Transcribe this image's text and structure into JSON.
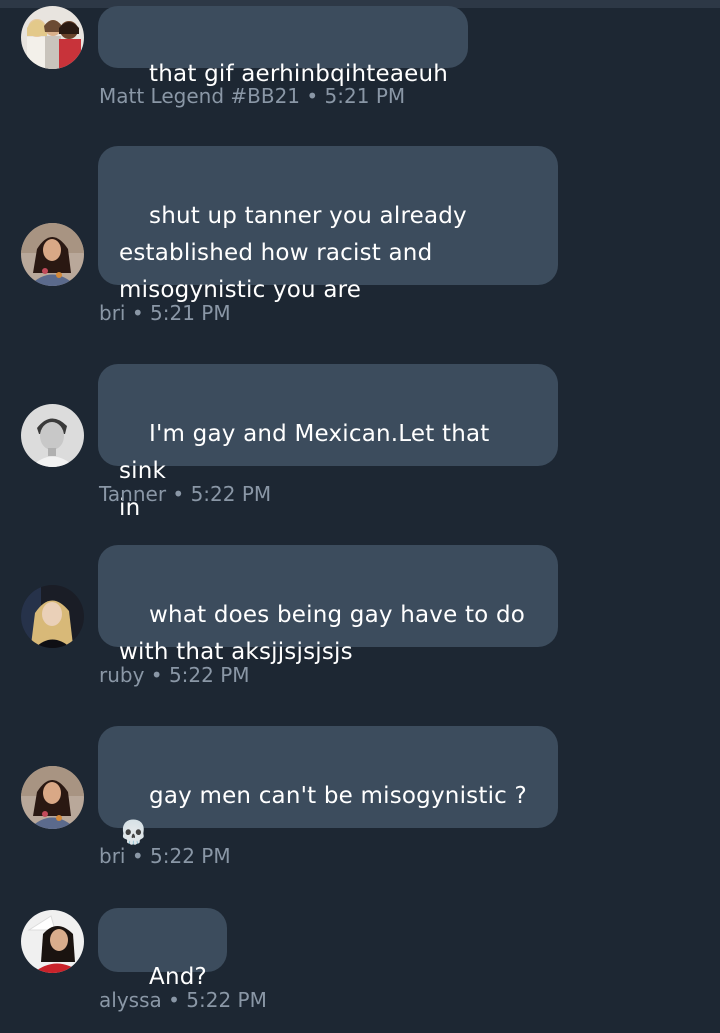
{
  "messages": [
    {
      "text": "that gif aerhinbqihteaeuh",
      "author": "Matt Legend #BB21",
      "time": "5:21 PM",
      "avatar_icon": "group-photo-avatar"
    },
    {
      "text": "shut up tanner you already\nestablished how racist and\nmisogynistic you are",
      "author": "bri",
      "time": "5:21 PM",
      "avatar_icon": "woman-dark-hair-avatar"
    },
    {
      "text": "I'm gay and Mexican.Let that sink\nin",
      "author": "Tanner",
      "time": "5:22 PM",
      "avatar_icon": "man-bw-portrait-avatar"
    },
    {
      "text": "what does being gay have to do\nwith that aksjjsjsjsjs",
      "author": "ruby",
      "time": "5:22 PM",
      "avatar_icon": "woman-blonde-avatar"
    },
    {
      "text": "gay men can't be misogynistic ?\n💀",
      "author": "bri",
      "time": "5:22 PM",
      "avatar_icon": "woman-dark-hair-avatar"
    },
    {
      "text": "And?",
      "author": "alyssa",
      "time": "5:22 PM",
      "avatar_icon": "woman-red-top-avatar"
    }
  ],
  "separator": "•",
  "colors": {
    "background": "#1d2733",
    "bubble": "#3c4c5d",
    "meta_text": "#8a97a6",
    "message_text": "#ffffff"
  }
}
